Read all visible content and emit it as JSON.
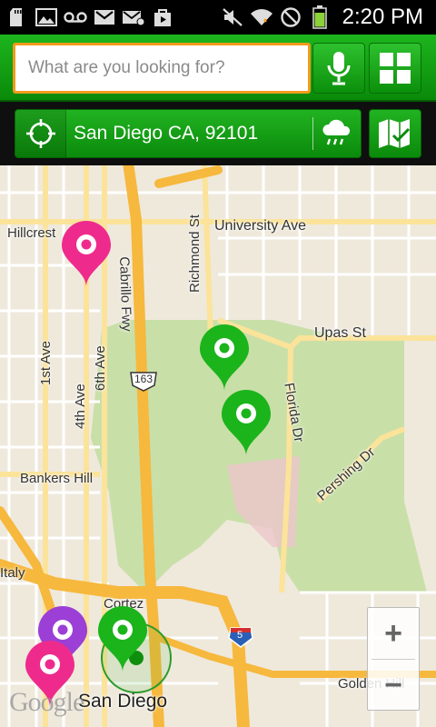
{
  "status_bar": {
    "time": "2:20 PM",
    "icons": [
      "sd-card-icon",
      "image-icon",
      "voicemail-icon",
      "gmail-icon",
      "email-icon",
      "play-store-icon",
      "mute-icon",
      "wifi-icon",
      "no-signal-icon",
      "battery-icon"
    ]
  },
  "search": {
    "placeholder": "What are you looking for?"
  },
  "location": {
    "text": "San Diego CA, 92101"
  },
  "map": {
    "labels": {
      "hillcrest": "Hillcrest",
      "university_ave": "University Ave",
      "richmond_st": "Richmond St",
      "cabrillo_fwy": "Cabrillo Fwy",
      "upas_st": "Upas St",
      "highway_163": "163",
      "first_ave": "1st Ave",
      "fourth_ave": "4th Ave",
      "sixth_ave": "6th Ave",
      "florida_dr": "Florida Dr",
      "bankers_hill": "Bankers Hill",
      "pershing_dr": "Pershing Dr",
      "italy": "Italy",
      "cortez": "Cortez",
      "interstate_5": "5",
      "golden_hill": "Golden Hill",
      "san_diego": "San Diego",
      "google": "Google"
    },
    "zoom_in": "+",
    "zoom_out": "−"
  },
  "colors": {
    "accent_green": "#12a012",
    "search_border": "#f39b1a",
    "pin_pink": "#ee2b8c",
    "pin_green": "#1bb41b",
    "pin_purple": "#9b3fd6",
    "park": "#c9dfa8",
    "freeway": "#f6b83d"
  }
}
